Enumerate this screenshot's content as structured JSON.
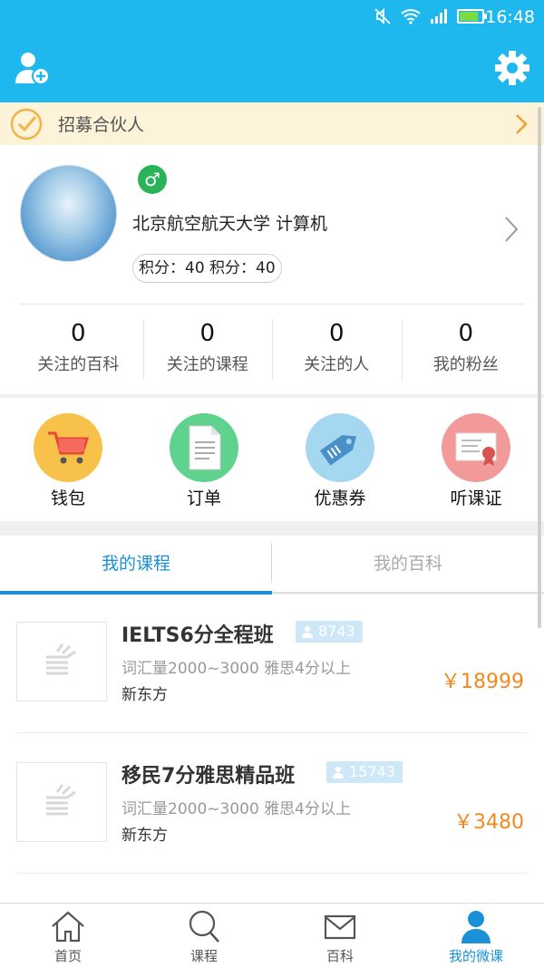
{
  "status_bar": {
    "time": "16:48"
  },
  "header": {
    "add_user_icon": "add-user-icon",
    "settings_icon": "gear-icon"
  },
  "recruit": {
    "label": "招募合伙人"
  },
  "profile": {
    "school_major": "北京航空航天大学 计算机",
    "score_text": "积分：40 积分：40",
    "gender_symbol": "♂"
  },
  "stats": [
    {
      "value": "0",
      "label": "关注的百科"
    },
    {
      "value": "0",
      "label": "关注的课程"
    },
    {
      "value": "0",
      "label": "关注的人"
    },
    {
      "value": "0",
      "label": "我的粉丝"
    }
  ],
  "tools": [
    {
      "label": "钱包",
      "icon": "cart-icon",
      "color": "#f8c24a"
    },
    {
      "label": "订单",
      "icon": "document-icon",
      "color": "#5fd28e"
    },
    {
      "label": "优惠券",
      "icon": "tag-icon",
      "color": "#a6d7f0"
    },
    {
      "label": "听课证",
      "icon": "certificate-icon",
      "color": "#f29a9a"
    }
  ],
  "tabs": {
    "active": "我的课程",
    "inactive": "我的百科"
  },
  "courses": [
    {
      "title": "IELTS6分全程班",
      "count": "8743",
      "desc": "词汇量2000~3000 雅思4分以上",
      "org": "新东方",
      "price": "￥18999"
    },
    {
      "title": "移民7分雅思精品班",
      "count": "15743",
      "desc": "词汇量2000~3000 雅思4分以上",
      "org": "新东方",
      "price": "￥3480"
    }
  ],
  "bottom_nav": [
    {
      "label": "首页",
      "icon": "home-icon"
    },
    {
      "label": "课程",
      "icon": "search-icon"
    },
    {
      "label": "百科",
      "icon": "mail-icon"
    },
    {
      "label": "我的微课",
      "icon": "user-icon"
    }
  ],
  "colors": {
    "primary": "#1fb8ee",
    "accent": "#1a90d8",
    "price": "#f08a1c"
  }
}
